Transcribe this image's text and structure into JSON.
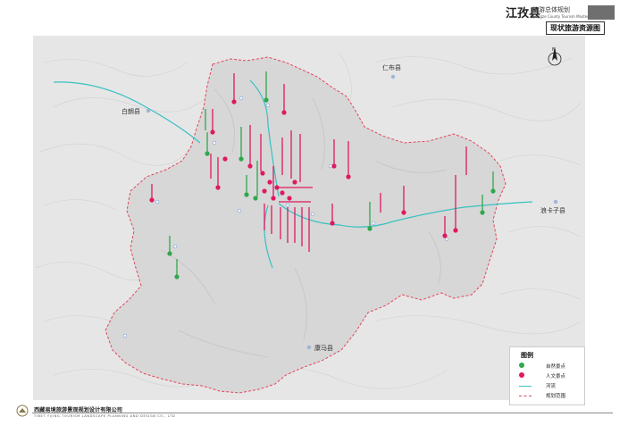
{
  "header": {
    "county": "江孜县",
    "plan": "旅游总体规划",
    "plan_en": "Gyangze County Tourism Master Plan",
    "map_title": "现状旅游资源图"
  },
  "map": {
    "places": {
      "renbu": "仁布县",
      "bailang": "白朗县",
      "langkazi": "浪卡子县",
      "kangma": "康马县"
    },
    "colors": {
      "natural": "#2fa84a",
      "cultural": "#e0185f",
      "river": "#39c0c2",
      "boundary": "#e3465c"
    }
  },
  "legend": {
    "title": "图例",
    "natural": "自然景点",
    "cultural": "人文景点",
    "river": "河流",
    "boundary": "规划范围"
  },
  "footer": {
    "company_cn": "西藏易境旅游景观规划设计有限公司",
    "company_en": "TIBET YIJING TOURISM LANDSCAPE PLANNING AND DESIGN CO., LTD"
  }
}
